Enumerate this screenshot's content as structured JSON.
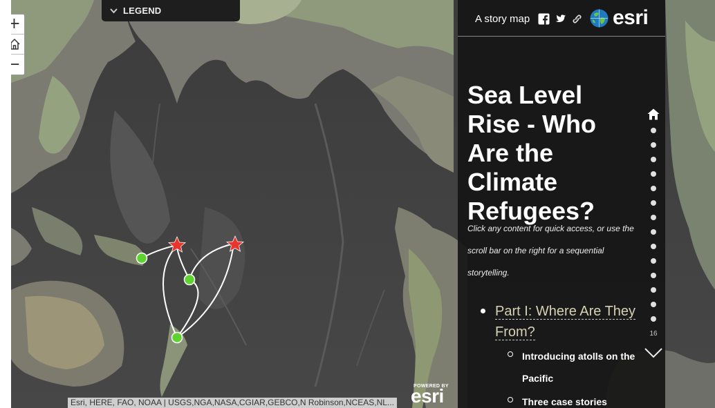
{
  "map": {
    "zoom_in_label": "+",
    "zoom_out_label": "−",
    "legend_label": "LEGEND",
    "attribution": "Esri, HERE, FAO, NOAA | USGS,NGA,NASA,CGIAR,GEBCO,N Robinson,NCEAS,NL...",
    "powered_small": "POWERED BY",
    "powered_brand": "esri",
    "marker_colors": {
      "origin": "#5ed32f",
      "destination": "#e8352d",
      "route": "#ffffff"
    }
  },
  "header": {
    "tagline": "A story map",
    "share_icons": [
      "facebook-icon",
      "twitter-icon",
      "link-icon"
    ],
    "brand": "esri"
  },
  "story": {
    "title": "Sea Level Rise - Who Are the Climate Refugees?",
    "intro": "Click any content for quick access, or use the scroll bar on the right for a sequential storytelling.",
    "toc": {
      "part1": "Part I: Where Are They From?",
      "sub1": "Introducing atolls on the Pacific",
      "sub2": "Three case stories"
    }
  },
  "navigation": {
    "section_count": "16",
    "dot_count": 14
  }
}
